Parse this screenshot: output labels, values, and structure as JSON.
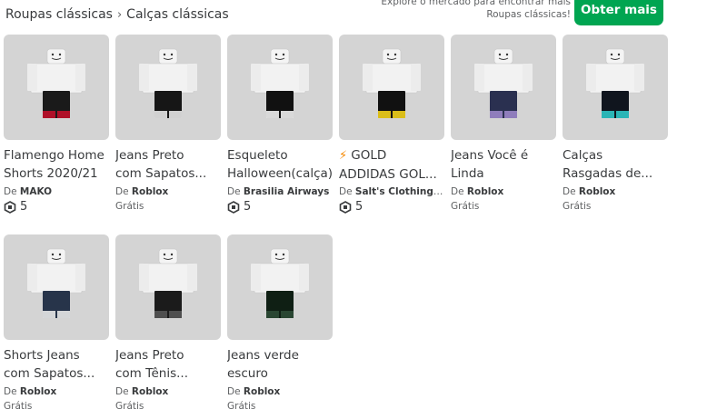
{
  "breadcrumb": {
    "parent": "Roupas clássicas",
    "current": "Calças clássicas"
  },
  "promo": {
    "line1": "Explore o mercado para encontrar mais",
    "line2": "Roupas clássicas!"
  },
  "get_more_label": "Obter mais",
  "by_prefix": "De",
  "items": [
    {
      "name": "Flamengo Home Shorts 2020/21",
      "name_lines": [
        "Flamengo Home",
        "Shorts 2020/21"
      ],
      "creator": "MAKO",
      "price": "5",
      "free": "",
      "pants_color": "#1a1a1a",
      "accent_color": "#c0102a",
      "icon": ""
    },
    {
      "name": "Jeans Preto com Sapatos...",
      "name_lines": [
        "Jeans Preto",
        "com Sapatos..."
      ],
      "creator": "Roblox",
      "price": "",
      "free": "Grátis",
      "pants_color": "#161616",
      "accent_color": "#e6e6e6",
      "icon": ""
    },
    {
      "name": "Esqueleto Halloween(calça)",
      "name_lines": [
        "Esqueleto",
        "Halloween(calça)"
      ],
      "creator": "Brasilia Airways",
      "price": "5",
      "free": "",
      "pants_color": "#111111",
      "accent_color": "#f0f0f0",
      "icon": ""
    },
    {
      "name": "GOLD ADDIDAS GOL...",
      "name_lines": [
        "GOLD",
        "ADDIDAS GOL..."
      ],
      "creator": "Salt's Clothing Fa...",
      "price": "5",
      "free": "",
      "pants_color": "#111111",
      "accent_color": "#f2d21b",
      "icon": "lightning-icon"
    },
    {
      "name": "Jeans Você é Linda",
      "name_lines": [
        "Jeans Você é",
        "Linda"
      ],
      "creator": "Roblox",
      "price": "",
      "free": "Grátis",
      "pants_color": "#2a3050",
      "accent_color": "#9a86c8",
      "icon": ""
    },
    {
      "name": "Calças Rasgadas de...",
      "name_lines": [
        "Calças",
        "Rasgadas de..."
      ],
      "creator": "Roblox",
      "price": "",
      "free": "Grátis",
      "pants_color": "#10151e",
      "accent_color": "#2ec7c7",
      "icon": ""
    },
    {
      "name": "Shorts Jeans com Sapatos...",
      "name_lines": [
        "Shorts Jeans",
        "com Sapatos..."
      ],
      "creator": "Roblox",
      "price": "",
      "free": "Grátis",
      "pants_color": "#27344a",
      "accent_color": "#e8e8e8",
      "icon": ""
    },
    {
      "name": "Jeans Preto com Tênis...",
      "name_lines": [
        "Jeans Preto",
        "com Tênis..."
      ],
      "creator": "Roblox",
      "price": "",
      "free": "Grátis",
      "pants_color": "#1b1b1b",
      "accent_color": "#555555",
      "icon": ""
    },
    {
      "name": "Jeans verde escuro",
      "name_lines": [
        "Jeans verde",
        "escuro"
      ],
      "creator": "Roblox",
      "price": "",
      "free": "Grátis",
      "pants_color": "#0f1f14",
      "accent_color": "#2c4a35",
      "icon": ""
    }
  ]
}
